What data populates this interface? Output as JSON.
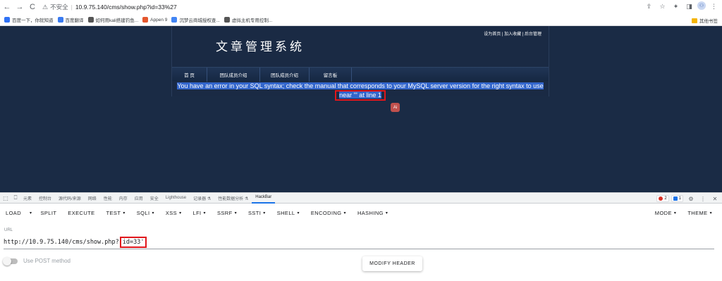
{
  "browser": {
    "back": "←",
    "forward": "→",
    "reload": "C",
    "security_icon": "⚠",
    "security_text": "不安全",
    "url": "10.9.75.140/cms/show.php?id=33%27",
    "right_icons": [
      "⇪",
      "☆",
      "✦",
      "◨"
    ],
    "profile": "⚇",
    "menu": "⋮"
  },
  "bookmarks": {
    "items": [
      {
        "label": "百度一下，你就知道",
        "color": "#3072f5"
      },
      {
        "label": "百度翻译",
        "color": "#3a7bf0"
      },
      {
        "label": "如何用kali搭建钓鱼...",
        "color": "#555555"
      },
      {
        "label": "Appen 9",
        "color": "#e4572e"
      },
      {
        "label": "沉梦云商城授权查...",
        "color": "#4285f4"
      },
      {
        "label": "虚拟主机专用控制...",
        "color": "#555555"
      }
    ],
    "other": "其他书签"
  },
  "site": {
    "top_links": "设为首页 | 加入收藏 | 后台管理",
    "title": "文章管理系统",
    "menu": [
      "首 页",
      "团队成员介绍",
      "团队成员介绍",
      "留言板"
    ],
    "error_text": "You have an error in your SQL syntax; check the manual that corresponds to your MySQL server version for the right syntax to use",
    "error_near": "near ''' at line 1",
    "ai_badge": "Ai"
  },
  "devtools": {
    "icons": [
      "⬚",
      "⎕"
    ],
    "tabs": [
      "元素",
      "控制台",
      "源代码/来源",
      "网络",
      "性能",
      "内存",
      "应用",
      "安全",
      "Lighthouse",
      "记录器 ⚗",
      "性能数据分析 ⚗",
      "HackBar"
    ],
    "active_tab": "HackBar",
    "errors": "2",
    "messages": "1",
    "gear": "⚙",
    "more": "⋮",
    "close": "✕"
  },
  "hackbar": {
    "buttons": [
      {
        "label": "LOAD",
        "caret": false
      },
      {
        "label": "▾",
        "caret": false
      },
      {
        "label": "SPLIT",
        "caret": false
      },
      {
        "label": "EXECUTE",
        "caret": false
      },
      {
        "label": "TEST",
        "caret": true
      },
      {
        "label": "SQLI",
        "caret": true
      },
      {
        "label": "XSS",
        "caret": true
      },
      {
        "label": "LFI",
        "caret": true
      },
      {
        "label": "SSRF",
        "caret": true
      },
      {
        "label": "SSTI",
        "caret": true
      },
      {
        "label": "SHELL",
        "caret": true
      },
      {
        "label": "ENCODING",
        "caret": true
      },
      {
        "label": "HASHING",
        "caret": true
      }
    ],
    "right_buttons": [
      {
        "label": "MODE",
        "caret": true
      },
      {
        "label": "THEME",
        "caret": true
      }
    ],
    "caret": "▾",
    "url_label": "URL",
    "url_prefix": "http://10.9.75.140/cms/show.php?",
    "url_param": "id=33'",
    "post_label": "Use POST method",
    "modify_header": "MODIFY HEADER"
  },
  "colors": {
    "page_bg": "#1a2b45",
    "highlight_box": "#e0161b",
    "selection": "#3366cc",
    "active_tab": "#1a73e8"
  }
}
